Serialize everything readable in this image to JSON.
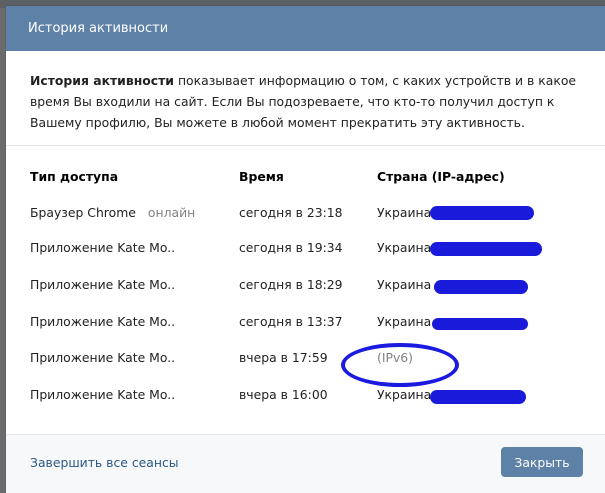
{
  "modal": {
    "title": "История активности",
    "intro_bold": "История активности",
    "intro_rest": " показывает информацию о том, с каких устройств и в какое время Вы входили на сайт. Если Вы подозреваете, что кто-то получил доступ к Вашему профилю, Вы можете в любой момент прекратить эту активность."
  },
  "table": {
    "headers": [
      "Тип доступа",
      "Время",
      "Страна (IP-адрес)"
    ],
    "rows": [
      {
        "access": "Браузер Chrome",
        "status": "онлайн",
        "time": "сегодня в 23:18",
        "country": "Украина"
      },
      {
        "access": "Приложение Kate Mo..",
        "status": "",
        "time": "сегодня в 19:34",
        "country": "Украина"
      },
      {
        "access": "Приложение Kate Mo..",
        "status": "",
        "time": "сегодня в 18:29",
        "country": "Украина"
      },
      {
        "access": "Приложение Kate Mo..",
        "status": "",
        "time": "сегодня в 13:37",
        "country": "Украина"
      },
      {
        "access": "Приложение Kate Mo..",
        "status": "",
        "time": "вчера в 17:59",
        "country": "(IPv6)"
      },
      {
        "access": "Приложение Kate Mo..",
        "status": "",
        "time": "вчера в 16:00",
        "country": "Украина"
      }
    ]
  },
  "footer": {
    "end_sessions": "Завершить все сеансы",
    "close": "Закрыть"
  },
  "colors": {
    "header_bg": "#5e81a8",
    "link": "#2a5885",
    "redaction": "#1a1adb"
  }
}
